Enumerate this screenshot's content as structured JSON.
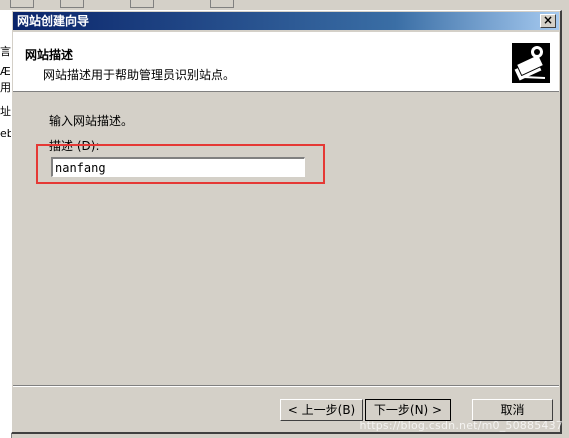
{
  "background": {
    "left_fragments": [
      "言",
      "Æ",
      "用",
      "址",
      "eb"
    ]
  },
  "dialog": {
    "title": "网站创建向导",
    "close_symbol": "×"
  },
  "header": {
    "title": "网站描述",
    "subtitle": "网站描述用于帮助管理员识别站点。",
    "icon": "wizard-site-icon"
  },
  "body": {
    "prompt": "输入网站描述。",
    "field_label": "描述",
    "field_accel": "(D):",
    "field_value": "nanfang"
  },
  "buttons": {
    "back": "< 上一步(B)",
    "next": "下一步(N) >",
    "cancel": "取消"
  },
  "watermark": "https://blog.csdn.net/m0_50885437",
  "colors": {
    "title_bar": "#0a246a",
    "dialog_bg": "#d4d0c8",
    "highlight": "#e53935"
  }
}
